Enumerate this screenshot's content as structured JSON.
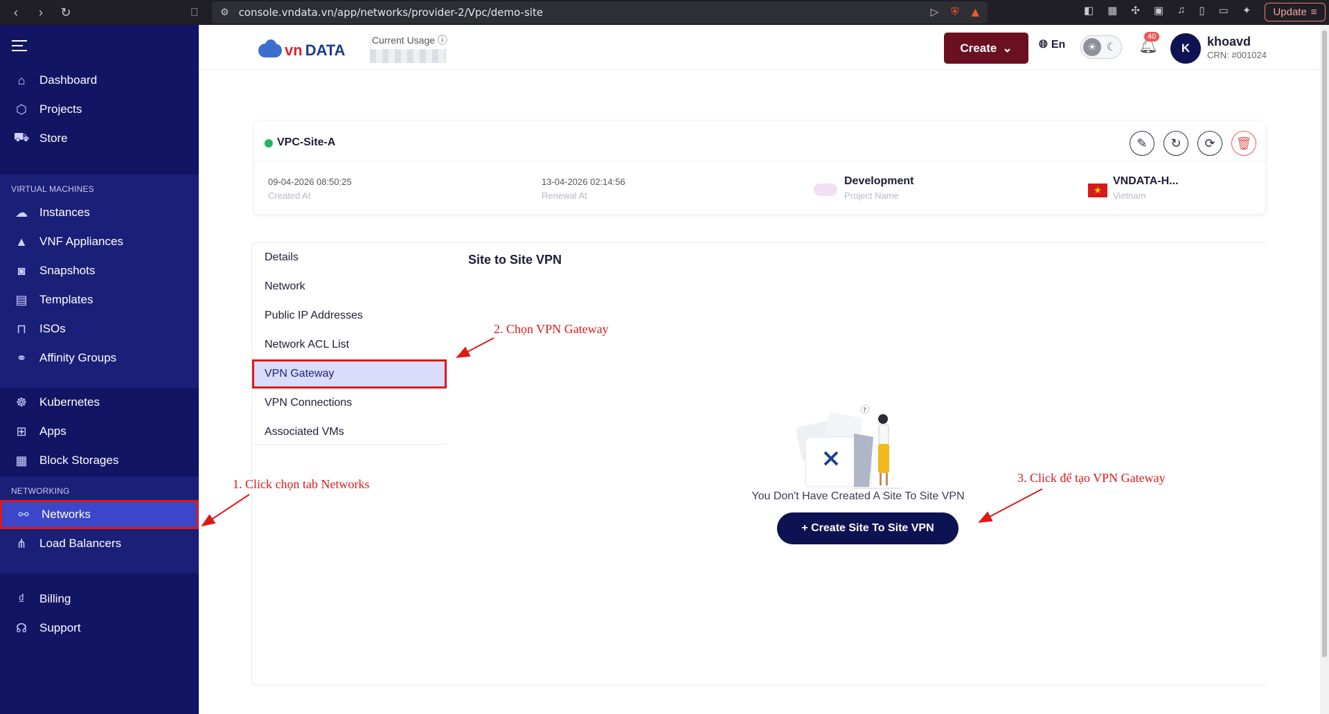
{
  "browser": {
    "url": "console.vndata.vn/app/networks/provider-2/Vpc/demo-site",
    "update_label": "Update"
  },
  "header": {
    "logo_left": "vn",
    "logo_right": "DATA",
    "usage_label": "Current Usage",
    "create_label": "Create",
    "lang": "En",
    "notifications": "40",
    "avatar_initial": "K",
    "username": "khoavd",
    "crn": "CRN: #001024"
  },
  "sidebar": {
    "top": [
      "Dashboard",
      "Projects",
      "Store"
    ],
    "vm_section": "VIRTUAL MACHINES",
    "vm": [
      "Instances",
      "VNF Appliances",
      "Snapshots",
      "Templates",
      "ISOs",
      "Affinity Groups"
    ],
    "mid": [
      "Kubernetes",
      "Apps",
      "Block Storages"
    ],
    "net_section": "NETWORKING",
    "net": [
      "Networks",
      "Load Balancers"
    ],
    "bottom": [
      "Billing",
      "Support"
    ]
  },
  "vpc": {
    "name": "VPC-Site-A",
    "status_color": "#1fb95a",
    "created_value": "09-04-2026 08:50:25",
    "created_label": "Created At",
    "renewal_value": "13-04-2026 02:14:56",
    "renewal_label": "Renewal At",
    "project_value": "Development",
    "project_label": "Project Name",
    "zone_value": "VNDATA-H...",
    "zone_label": "Vietnam"
  },
  "tabs": [
    "Details",
    "Network",
    "Public IP Addresses",
    "Network ACL List",
    "VPN Gateway",
    "VPN Connections",
    "Associated VMs"
  ],
  "content": {
    "title": "Site to Site VPN",
    "empty_text": "You Don't Have Created A Site To Site VPN",
    "button": "+ Create Site To Site VPN"
  },
  "annotations": {
    "step1": "1. Click chọn tab Networks",
    "step2": "2. Chọn VPN Gateway",
    "step3": "3. Click để tạo VPN Gateway",
    "color": "#e01818"
  }
}
